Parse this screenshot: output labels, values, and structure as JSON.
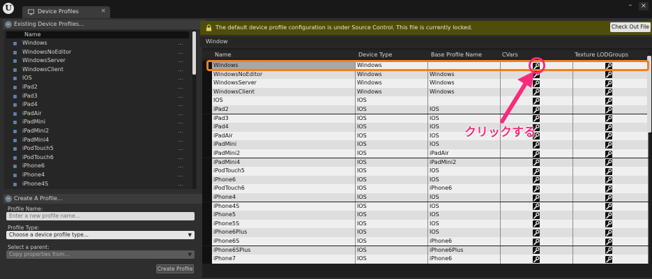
{
  "tab": {
    "title": "Device Profiles",
    "close": "×"
  },
  "window_controls": {
    "minimize": "–",
    "close": "×"
  },
  "existing_panel": {
    "title": "Existing Device Profiles...",
    "header": "Name",
    "items": [
      "Windows",
      "WindowsNoEditor",
      "WindowsServer",
      "WindowsClient",
      "IOS",
      "iPad2",
      "iPad3",
      "iPad4",
      "iPadAir",
      "iPadMini",
      "iPadMini2",
      "iPadMini4",
      "iPodTouch5",
      "iPodTouch6",
      "iPhone6",
      "iPhone4",
      "iPhone4S"
    ],
    "row_menu": "..."
  },
  "create_panel": {
    "title": "Create A Profile...",
    "name_label": "Profile Name:",
    "name_placeholder": "Enter a new profile name...",
    "type_label": "Profile Type:",
    "type_value": "Choose a device profile type...",
    "parent_label": "Select a parent:",
    "parent_value": "Copy properties from...",
    "create_button": "Create Profile"
  },
  "banner": {
    "message": "The default device profile configuration is under Source Control. This file is currently locked.",
    "checkout_button": "Check Out File",
    "color": "#4e4e0a"
  },
  "window_section": "Window",
  "grid": {
    "columns": [
      "Name",
      "Device Type",
      "Base Profile Name",
      "CVars",
      "Texture LODGroups"
    ],
    "rows": [
      {
        "name": "Windows",
        "type": "Windows",
        "base": ""
      },
      {
        "name": "WindowsNoEditor",
        "type": "Windows",
        "base": "Windows"
      },
      {
        "name": "WindowsServer",
        "type": "Windows",
        "base": "Windows"
      },
      {
        "name": "WindowsClient",
        "type": "Windows",
        "base": "Windows"
      },
      {
        "name": "IOS",
        "type": "IOS",
        "base": ""
      },
      {
        "name": "iPad2",
        "type": "IOS",
        "base": "IOS"
      },
      {
        "name": "iPad3",
        "type": "IOS",
        "base": "IOS"
      },
      {
        "name": "iPad4",
        "type": "IOS",
        "base": "IOS"
      },
      {
        "name": "iPadAir",
        "type": "IOS",
        "base": "IOS"
      },
      {
        "name": "iPadMini",
        "type": "IOS",
        "base": "IOS"
      },
      {
        "name": "iPadMini2",
        "type": "IOS",
        "base": "iPadAir"
      },
      {
        "name": "iPadMini4",
        "type": "IOS",
        "base": "iPadMini2"
      },
      {
        "name": "iPodTouch5",
        "type": "IOS",
        "base": "IOS"
      },
      {
        "name": "iPhone6",
        "type": "IOS",
        "base": "IOS"
      },
      {
        "name": "iPodTouch6",
        "type": "IOS",
        "base": "iPhone6"
      },
      {
        "name": "iPhone4",
        "type": "IOS",
        "base": "IOS"
      },
      {
        "name": "iPhone4S",
        "type": "IOS",
        "base": "IOS"
      },
      {
        "name": "iPhone5",
        "type": "IOS",
        "base": "IOS"
      },
      {
        "name": "iPhone5S",
        "type": "IOS",
        "base": "IOS"
      },
      {
        "name": "iPhone6Plus",
        "type": "IOS",
        "base": "IOS"
      },
      {
        "name": "iPhone6S",
        "type": "IOS",
        "base": "iPhone6"
      },
      {
        "name": "iPhone6SPlus",
        "type": "IOS",
        "base": "iPhone6Plus"
      },
      {
        "name": "iPhone7",
        "type": "IOS",
        "base": "iPhone6"
      }
    ]
  },
  "annotation": {
    "text": "クリックする",
    "color": "#ff2a7a",
    "highlight_color": "#f08020"
  }
}
